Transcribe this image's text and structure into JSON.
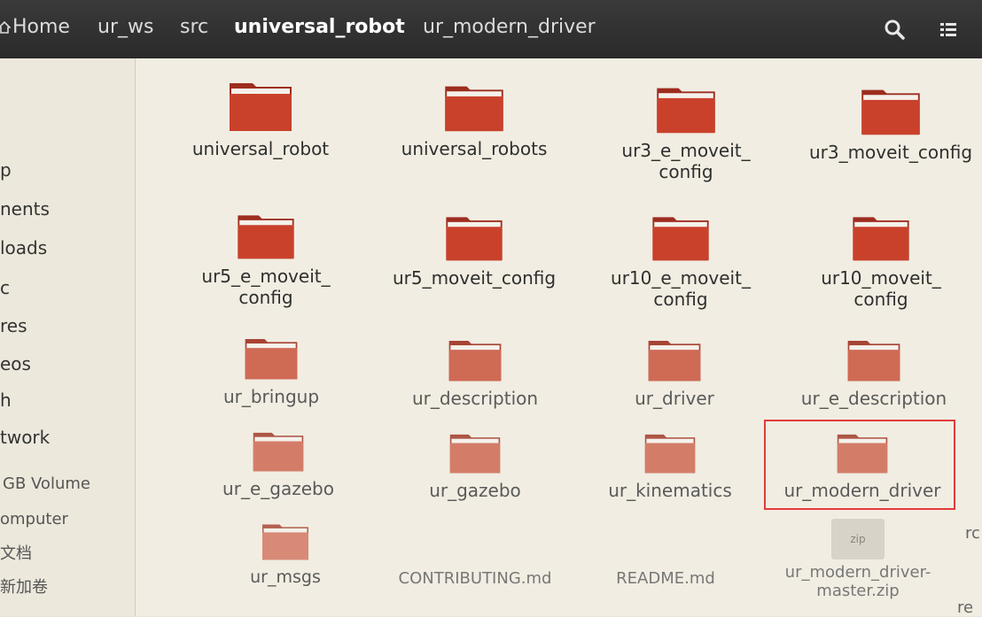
{
  "breadcrumbs": [
    {
      "label": "Home"
    },
    {
      "label": "ur_ws"
    },
    {
      "label": "src"
    },
    {
      "label": "universal_robot"
    },
    {
      "label": "ur_modern_driver"
    }
  ],
  "sidebar": {
    "items": [
      {
        "label": "p"
      },
      {
        "label": "nents"
      },
      {
        "label": "loads"
      },
      {
        "label": "c"
      },
      {
        "label": "res"
      },
      {
        "label": "eos"
      },
      {
        "label": "h"
      },
      {
        "label": "twork"
      },
      {
        "label": "GB Volume"
      },
      {
        "label": "omputer"
      },
      {
        "label": "文档"
      },
      {
        "label": "新加卷"
      }
    ]
  },
  "files": [
    {
      "name": "universal_robot",
      "line2": ""
    },
    {
      "name": "universal_robots",
      "line2": ""
    },
    {
      "name": "ur3_e_moveit_",
      "line2": "config"
    },
    {
      "name": "ur3_moveit_config",
      "line2": ""
    },
    {
      "name": "ur5_e_moveit_",
      "line2": "config"
    },
    {
      "name": "ur5_moveit_config",
      "line2": ""
    },
    {
      "name": "ur10_e_moveit_",
      "line2": "config"
    },
    {
      "name": "ur10_moveit_",
      "line2": "config"
    },
    {
      "name": "ur_bringup",
      "line2": ""
    },
    {
      "name": "ur_description",
      "line2": ""
    },
    {
      "name": "ur_driver",
      "line2": ""
    },
    {
      "name": "ur_e_description",
      "line2": ""
    },
    {
      "name": "ur_e_gazebo",
      "line2": ""
    },
    {
      "name": "ur_gazebo",
      "line2": ""
    },
    {
      "name": "ur_kinematics",
      "line2": ""
    },
    {
      "name": "ur_modern_driver",
      "line2": ""
    },
    {
      "name": "ur_msgs",
      "line2": ""
    },
    {
      "name": "CONTRIBUTING.md",
      "line2": ""
    },
    {
      "name": "README.md",
      "line2": ""
    },
    {
      "name": "ur_modern_driver-",
      "line2": "master.zip"
    }
  ],
  "zip_badge": "zip",
  "edge_text": {
    "right1": "rc",
    "right2": "re"
  },
  "colors": {
    "folder": "#c9412b",
    "selection": "#e23b3b",
    "header": "#2f2f2f"
  }
}
